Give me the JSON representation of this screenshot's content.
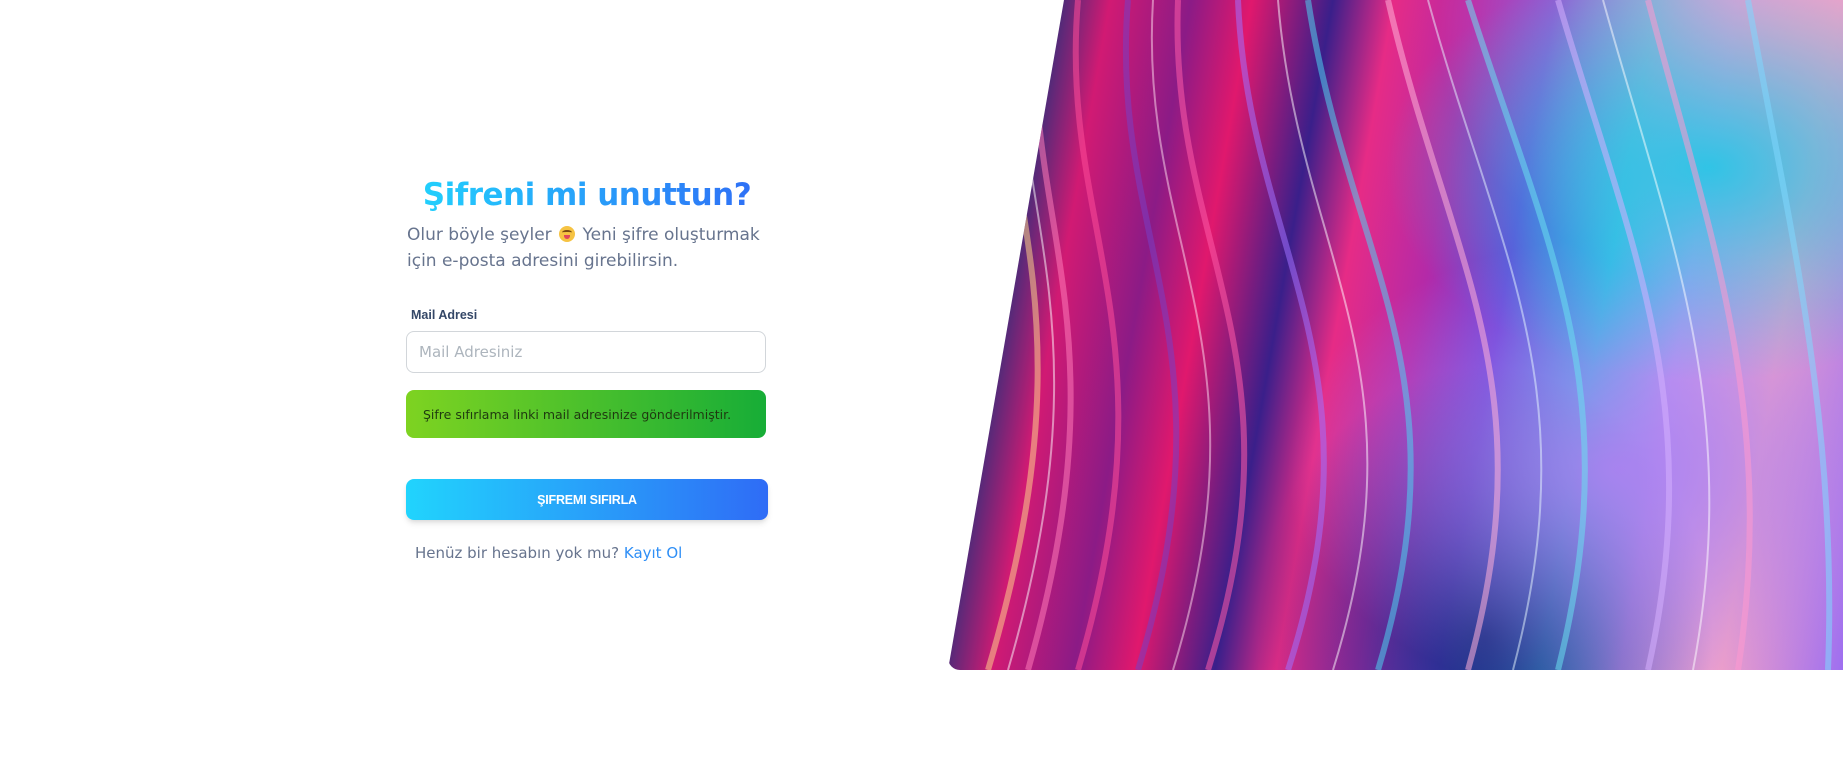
{
  "form": {
    "title": "Şifreni mi unuttun?",
    "subtitle_before_emoji": "Olur böyle şeyler",
    "subtitle_after_emoji": "Yeni şifre oluşturmak için e-posta adresini girebilirsin.",
    "email_label": "Mail Adresi",
    "email_placeholder": "Mail Adresiniz",
    "email_value": "",
    "success_alert": "Şifre sıfırlama linki mail adresinize gönderilmiştir.",
    "submit_label": "ŞIFREMI SIFIRLA",
    "signup_prompt": "Henüz bir hesabın yok mu?",
    "signup_link": "Kayıt Ol"
  },
  "colors": {
    "title_gradient": [
      "#21d4fd",
      "#2f6cf6"
    ],
    "alert_gradient": [
      "#7ed321",
      "#17ad37"
    ],
    "button_gradient": [
      "#21d4fd",
      "#2f6cf6"
    ],
    "link": "#2f8ff6",
    "muted_text": "#67748e"
  },
  "icons": {
    "subtitle_emoji": "drooling-face-emoji"
  }
}
